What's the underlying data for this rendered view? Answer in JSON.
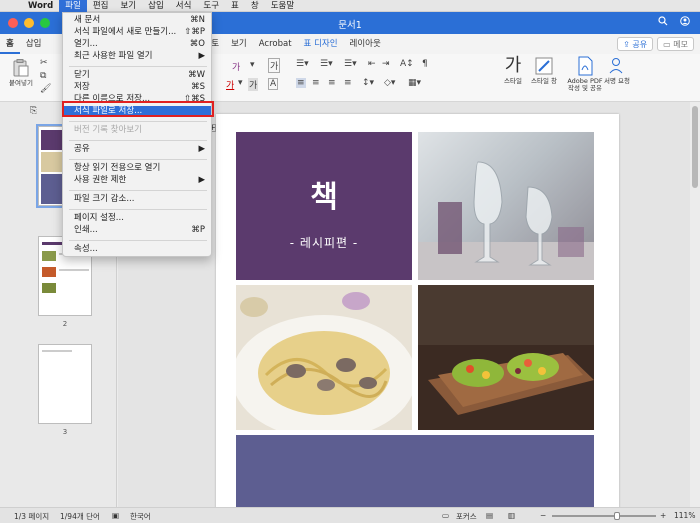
{
  "menubar": {
    "app": "Word",
    "items": [
      "파일",
      "편집",
      "보기",
      "삽입",
      "서식",
      "도구",
      "표",
      "창",
      "도움말"
    ],
    "active_index": 0
  },
  "window": {
    "title": "문서1"
  },
  "ribbon": {
    "tabs_visible": [
      "홈",
      "삽입",
      "검토",
      "보기",
      "Acrobat",
      "표 디자인",
      "레이아웃"
    ],
    "share_label": "공유",
    "memo_label": "메모",
    "paste_label": "붙여넣기",
    "styles_label": "스타일",
    "styles_pane_label": "스타일 창",
    "adobe_label": "Adobe PDF 작성 및 공유",
    "signature_label": "서명 요청"
  },
  "file_menu": {
    "items": [
      {
        "label": "새 문서",
        "shortcut": "⌘N",
        "enabled": true
      },
      {
        "label": "서식 파일에서 새로 만들기...",
        "shortcut": "⇧⌘P",
        "enabled": true
      },
      {
        "label": "열기...",
        "shortcut": "⌘O",
        "enabled": true
      },
      {
        "label": "최근 사용한 파일 열기",
        "shortcut": "▶",
        "enabled": true
      },
      {
        "label": "닫기",
        "shortcut": "⌘W",
        "enabled": true
      },
      {
        "label": "저장",
        "shortcut": "⌘S",
        "enabled": true
      },
      {
        "label": "다른 이름으로 저장...",
        "shortcut": "⇧⌘S",
        "enabled": true
      },
      {
        "label": "서식 파일로 저장...",
        "shortcut": "",
        "enabled": true,
        "highlighted": true
      },
      {
        "label": "버전 기록 찾아보기",
        "shortcut": "",
        "enabled": false
      },
      {
        "label": "공유",
        "shortcut": "▶",
        "enabled": true
      },
      {
        "label": "항상 읽기 전용으로 열기",
        "shortcut": "",
        "enabled": true
      },
      {
        "label": "사용 권한 제한",
        "shortcut": "▶",
        "enabled": true
      },
      {
        "label": "파일 크기 감소...",
        "shortcut": "",
        "enabled": true
      },
      {
        "label": "페이지 설정...",
        "shortcut": "",
        "enabled": true
      },
      {
        "label": "인쇄...",
        "shortcut": "⌘P",
        "enabled": true
      },
      {
        "label": "속성...",
        "shortcut": "",
        "enabled": true
      }
    ]
  },
  "document": {
    "cover_title": "책",
    "cover_subtitle": "- 레시피편 -",
    "accent_purple": "#5b3a6d",
    "band_color": "#5d5e91"
  },
  "thumbnails": {
    "page_numbers": [
      "2",
      "3"
    ]
  },
  "statusbar": {
    "page": "1/3 페이지",
    "words": "1/94개 단어",
    "language": "한국어",
    "focus": "포커스",
    "zoom": "111%"
  }
}
